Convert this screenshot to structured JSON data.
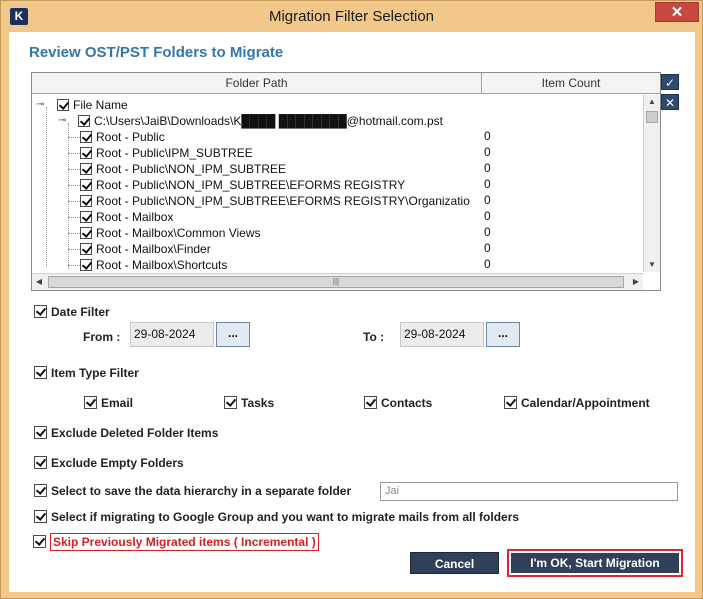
{
  "window": {
    "title": "Migration Filter Selection",
    "app_icon": "K",
    "close_glyph": "✕"
  },
  "heading": "Review OST/PST Folders to Migrate",
  "tree": {
    "columns": [
      "Folder Path",
      "Item Count"
    ],
    "root_label": "File Name",
    "file_label": "C:\\Users\\JaiB\\Downloads\\K████ ████████@hotmail.com.pst",
    "rows": [
      {
        "path": "Root - Public",
        "count": "0"
      },
      {
        "path": "Root - Public\\IPM_SUBTREE",
        "count": "0"
      },
      {
        "path": "Root - Public\\NON_IPM_SUBTREE",
        "count": "0"
      },
      {
        "path": "Root - Public\\NON_IPM_SUBTREE\\EFORMS REGISTRY",
        "count": "0"
      },
      {
        "path": "Root - Public\\NON_IPM_SUBTREE\\EFORMS REGISTRY\\Organizatio",
        "count": "0"
      },
      {
        "path": "Root - Mailbox",
        "count": "0"
      },
      {
        "path": "Root - Mailbox\\Common Views",
        "count": "0"
      },
      {
        "path": "Root - Mailbox\\Finder",
        "count": "0"
      },
      {
        "path": "Root - Mailbox\\Shortcuts",
        "count": "0"
      }
    ]
  },
  "side_buttons": {
    "check_all": "✓",
    "uncheck_all": "✕"
  },
  "date_filter": {
    "label": "Date Filter",
    "from_label": "From :",
    "from_value": "29-08-2024",
    "to_label": "To :",
    "to_value": "29-08-2024",
    "picker_label": "..."
  },
  "item_type_filter": {
    "label": "Item Type Filter",
    "types": [
      "Email",
      "Tasks",
      "Contacts",
      "Calendar/Appointment"
    ]
  },
  "options": {
    "exclude_deleted": "Exclude Deleted Folder Items",
    "exclude_empty": "Exclude Empty Folders",
    "save_hierarchy": "Select to save the data hierarchy in a separate folder",
    "hierarchy_value": "Jai",
    "google_group": "Select if migrating to Google Group and you want to migrate mails from all folders",
    "skip_migrated": "Skip Previously Migrated items ( Incremental )"
  },
  "buttons": {
    "cancel": "Cancel",
    "start": "I'm OK, Start Migration"
  },
  "colors": {
    "heading": "#3575ae",
    "accent_red": "#e0262c",
    "button_bg": "#2f4058",
    "frame": "#f2c88a"
  }
}
